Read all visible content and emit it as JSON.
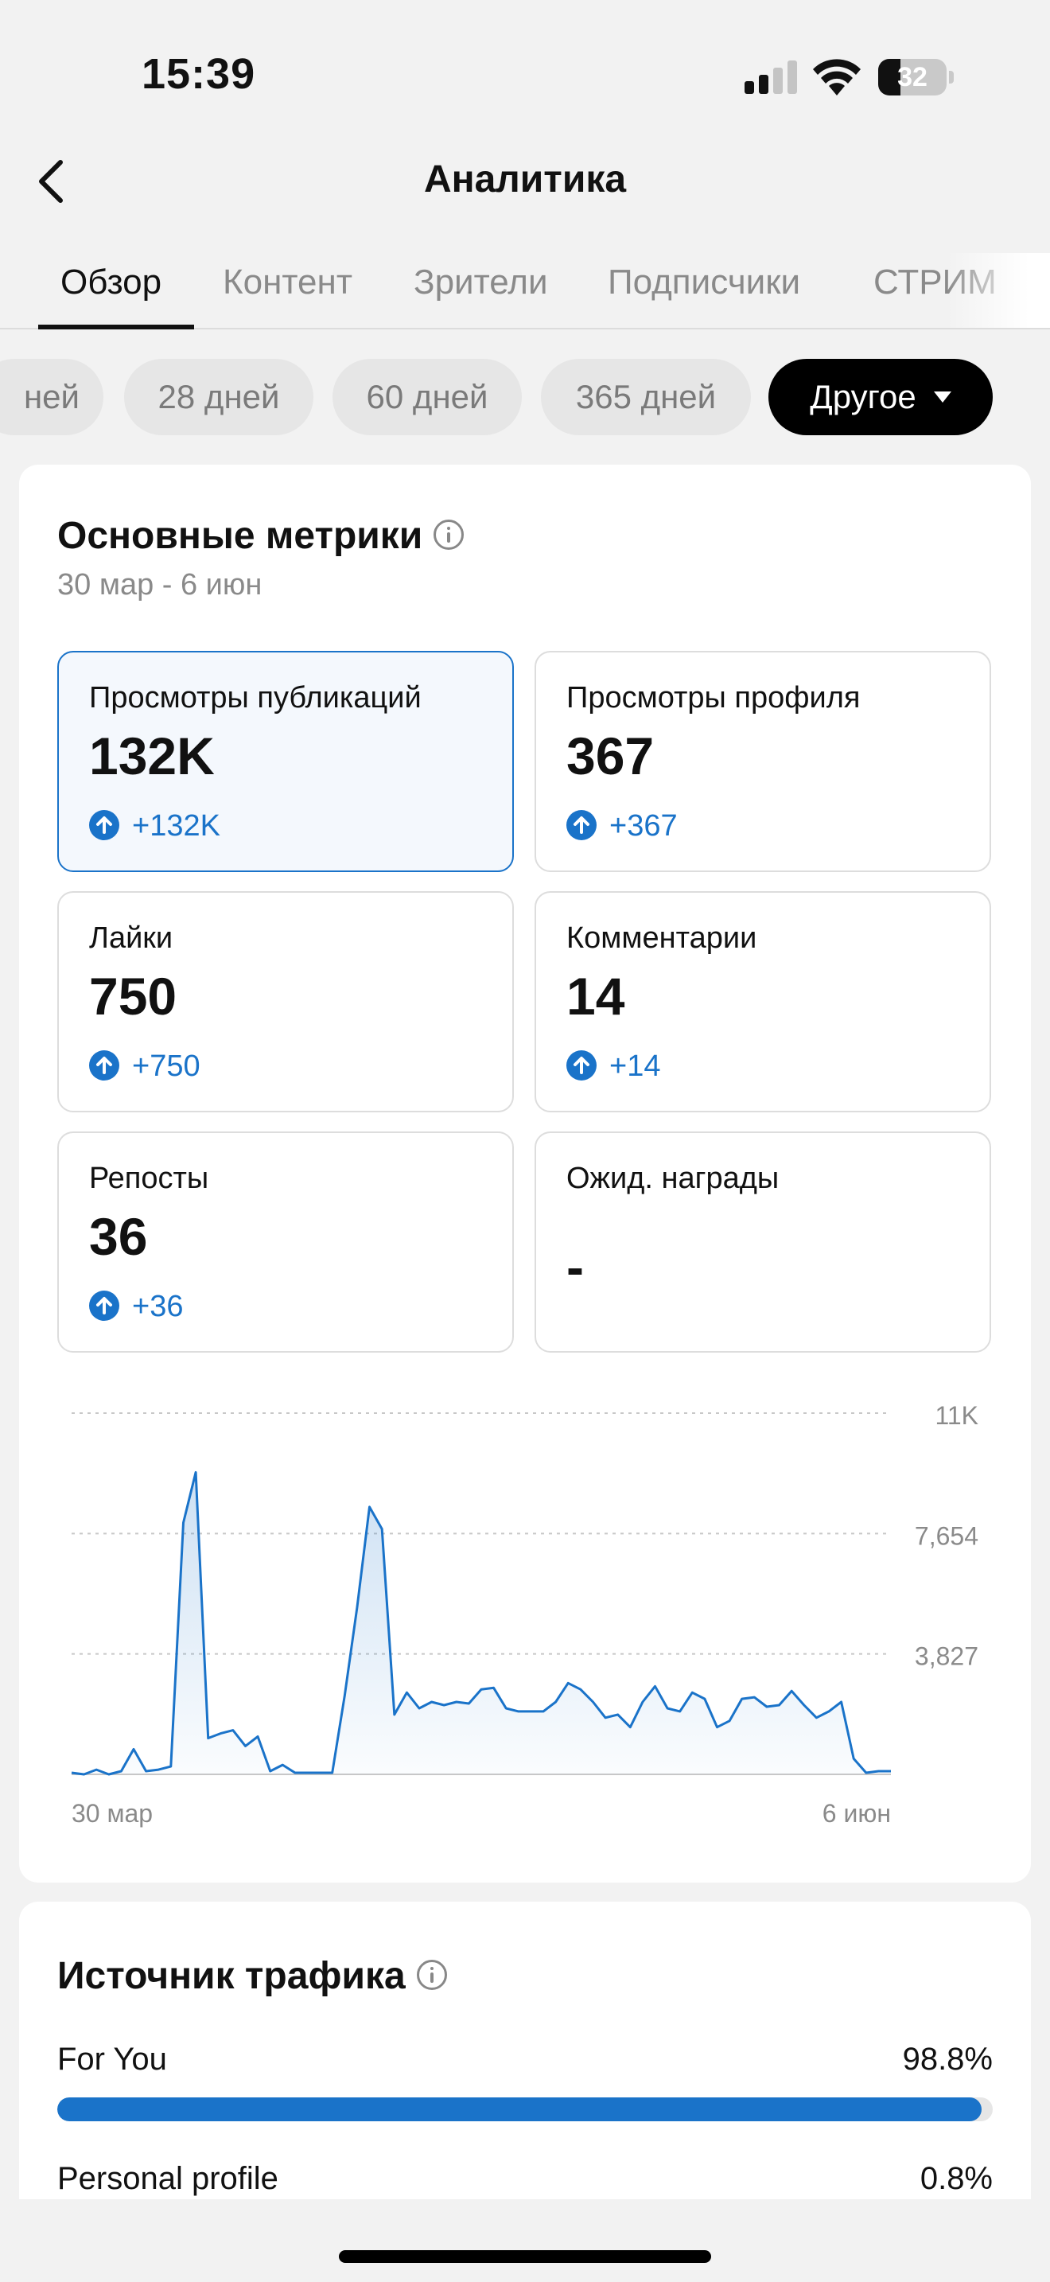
{
  "status_bar": {
    "time": "15:39",
    "battery": "32",
    "battery_level": 0.32
  },
  "header": {
    "title": "Аналитика"
  },
  "tabs": [
    {
      "label": "Обзор",
      "active": true
    },
    {
      "label": "Контент",
      "active": false
    },
    {
      "label": "Зрители",
      "active": false
    },
    {
      "label": "Подписчики",
      "active": false
    },
    {
      "label": "СТРИМ",
      "active": false
    }
  ],
  "chips": [
    {
      "label": "ней"
    },
    {
      "label": "28 дней"
    },
    {
      "label": "60 дней"
    },
    {
      "label": "365 дней"
    },
    {
      "label": "Другое",
      "selected": true
    }
  ],
  "metrics_card": {
    "title": "Основные метрики",
    "date_range": "30 мар - 6 июн",
    "metrics": [
      {
        "label": "Просмотры публикаций",
        "value": "132K",
        "delta": "+132K",
        "selected": true
      },
      {
        "label": "Просмотры профиля",
        "value": "367",
        "delta": "+367"
      },
      {
        "label": "Лайки",
        "value": "750",
        "delta": "+750"
      },
      {
        "label": "Комментарии",
        "value": "14",
        "delta": "+14"
      },
      {
        "label": "Репосты",
        "value": "36",
        "delta": "+36"
      },
      {
        "label": "Ожид. награды",
        "value": "-",
        "delta": ""
      }
    ]
  },
  "chart_data": {
    "type": "area",
    "x_start_label": "30 мар",
    "x_end_label": "6 июн",
    "y_tick_labels": [
      "11K",
      "7,654",
      "3,827"
    ],
    "ylim": [
      0,
      11481
    ],
    "grid": true,
    "color": "#1a73c9",
    "values": [
      50,
      0,
      150,
      0,
      100,
      800,
      100,
      150,
      250,
      8000,
      9600,
      1150,
      1300,
      1400,
      900,
      1200,
      100,
      300,
      50,
      50,
      50,
      50,
      2500,
      5300,
      8500,
      7800,
      1900,
      2600,
      2100,
      2300,
      2200,
      2300,
      2250,
      2700,
      2750,
      2100,
      2000,
      2000,
      2000,
      2300,
      2900,
      2700,
      2300,
      1800,
      1900,
      1500,
      2300,
      2800,
      2100,
      2000,
      2600,
      2400,
      1500,
      1700,
      2400,
      2450,
      2150,
      2200,
      2650,
      2200,
      1800,
      2000,
      2300,
      500,
      50,
      100,
      100
    ]
  },
  "traffic_card": {
    "title": "Источник трафика",
    "sources": [
      {
        "label": "For You",
        "value": "98.8%",
        "fraction": 0.988
      },
      {
        "label": "Personal profile",
        "value": "0.8%",
        "fraction": 0.008
      }
    ]
  },
  "colors": {
    "accent": "#1a73c9",
    "chip_selected": "#000000",
    "background": "#f2f2f2"
  }
}
